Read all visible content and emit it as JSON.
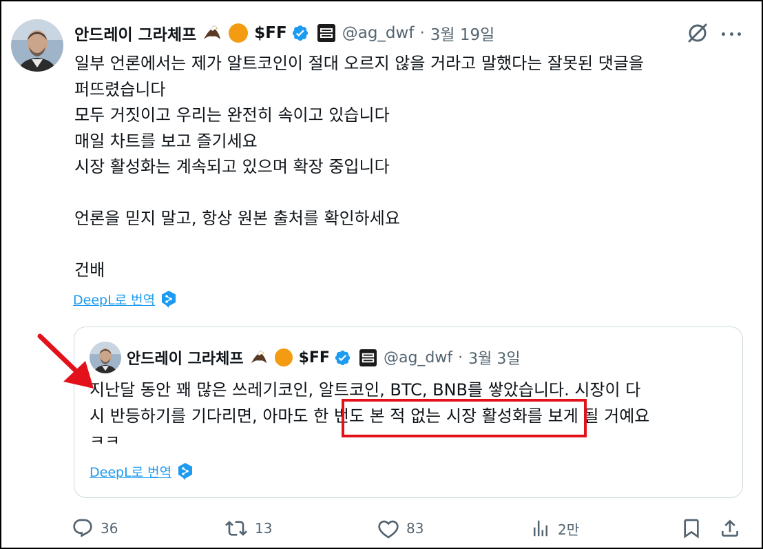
{
  "colors": {
    "text": "#0f1419",
    "muted": "#536471",
    "link": "#1d9bf0",
    "verified": "#1d9bf0",
    "highlight": "#e2111a"
  },
  "tweet": {
    "author": {
      "display_name": "안드레이 그라체프",
      "ticker": "$FF",
      "handle": "@ag_dwf",
      "date": "3월 19일",
      "dot": "·"
    },
    "lines": [
      "일부 언론에서는 제가 알트코인이 절대 오르지 않을 거라고 말했다는 잘못된 댓글을",
      "퍼뜨렸습니다",
      "모두 거짓이고 우리는 완전히 속이고 있습니다",
      "매일 차트를 보고 즐기세요",
      "시장 활성화는 계속되고 있으며 확장 중입니다",
      "",
      "언론을 믿지 말고, 항상 원본 출처를 확인하세요",
      "",
      "건배"
    ],
    "translate_label": "DeepL로 번역"
  },
  "quote": {
    "author": {
      "display_name": "안드레이 그라체프",
      "ticker": "$FF",
      "handle": "@ag_dwf",
      "date": "3월 3일",
      "dot": "·"
    },
    "lines": [
      "지난달 동안 꽤 많은 쓰레기코인, 알트코인, BTC, BNB를 쌓았습니다. 시장이 다",
      "시 반등하기를 기다리면, 아마도 한 번도 본 적 없는 시장 활성화를 보게 될 거예요",
      "ㅋㅋ"
    ],
    "translate_label": "DeepL로 번역"
  },
  "actions": {
    "replies": "36",
    "reposts": "13",
    "likes": "83",
    "views": "2만"
  },
  "icons": {
    "reply": "reply-icon",
    "repost": "repost-icon",
    "like": "heart-icon",
    "views": "views-icon",
    "bookmark": "bookmark-icon",
    "share": "share-icon",
    "grok": "grok-icon",
    "more": "more-icon"
  }
}
